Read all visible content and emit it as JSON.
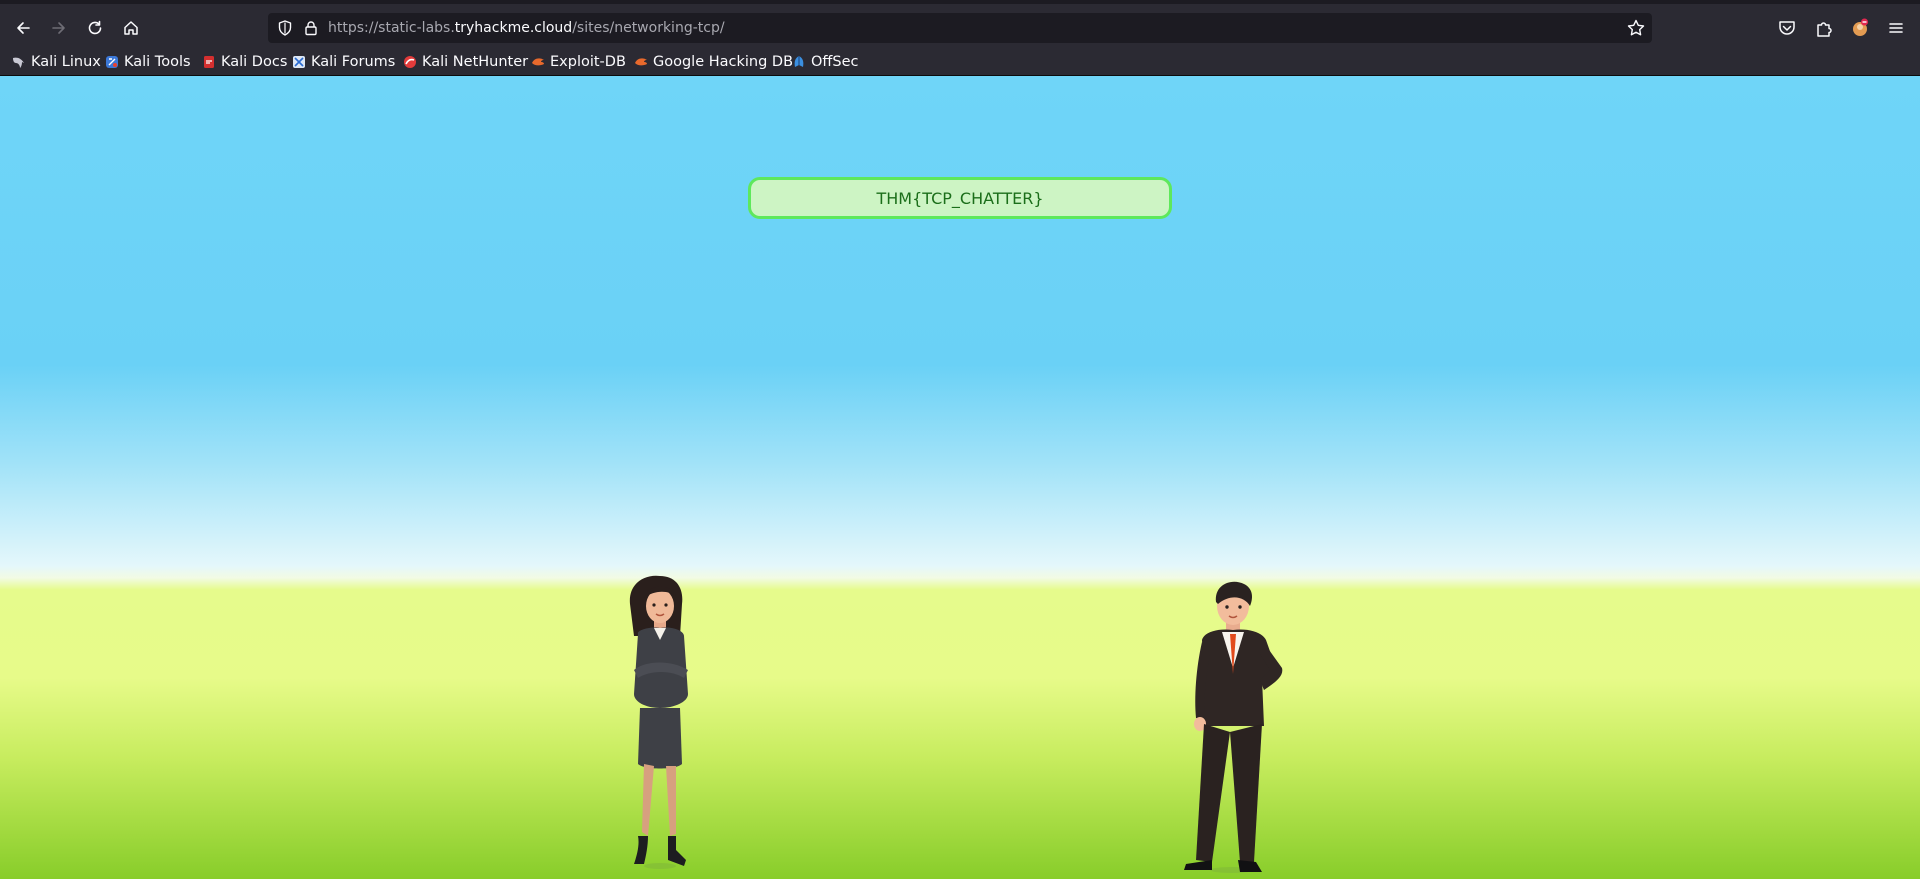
{
  "browser": {
    "url_prefix": "https://static-labs.",
    "url_host": "tryhackme.cloud",
    "url_path": "/sites/networking-tcp/"
  },
  "bookmarks": [
    {
      "label": "Kali Linux",
      "icon": "kali-dragon-icon"
    },
    {
      "label": "Kali Tools",
      "icon": "kali-tools-icon"
    },
    {
      "label": "Kali Docs",
      "icon": "kali-docs-icon"
    },
    {
      "label": "Kali Forums",
      "icon": "kali-forums-icon"
    },
    {
      "label": "Kali NetHunter",
      "icon": "nethunter-icon"
    },
    {
      "label": "Exploit-DB",
      "icon": "exploit-db-icon"
    },
    {
      "label": "Google Hacking DB",
      "icon": "ghdb-icon"
    },
    {
      "label": "OffSec",
      "icon": "offsec-icon"
    }
  ],
  "page": {
    "flag_text": "THM{TCP_CHATTER}"
  },
  "colors": {
    "sky": "#6fd5f8",
    "grass": "#e6fb8c",
    "flag_border": "#5ee85c",
    "flag_bg": "#cdf4c4",
    "flag_text": "#1b6e1a"
  }
}
